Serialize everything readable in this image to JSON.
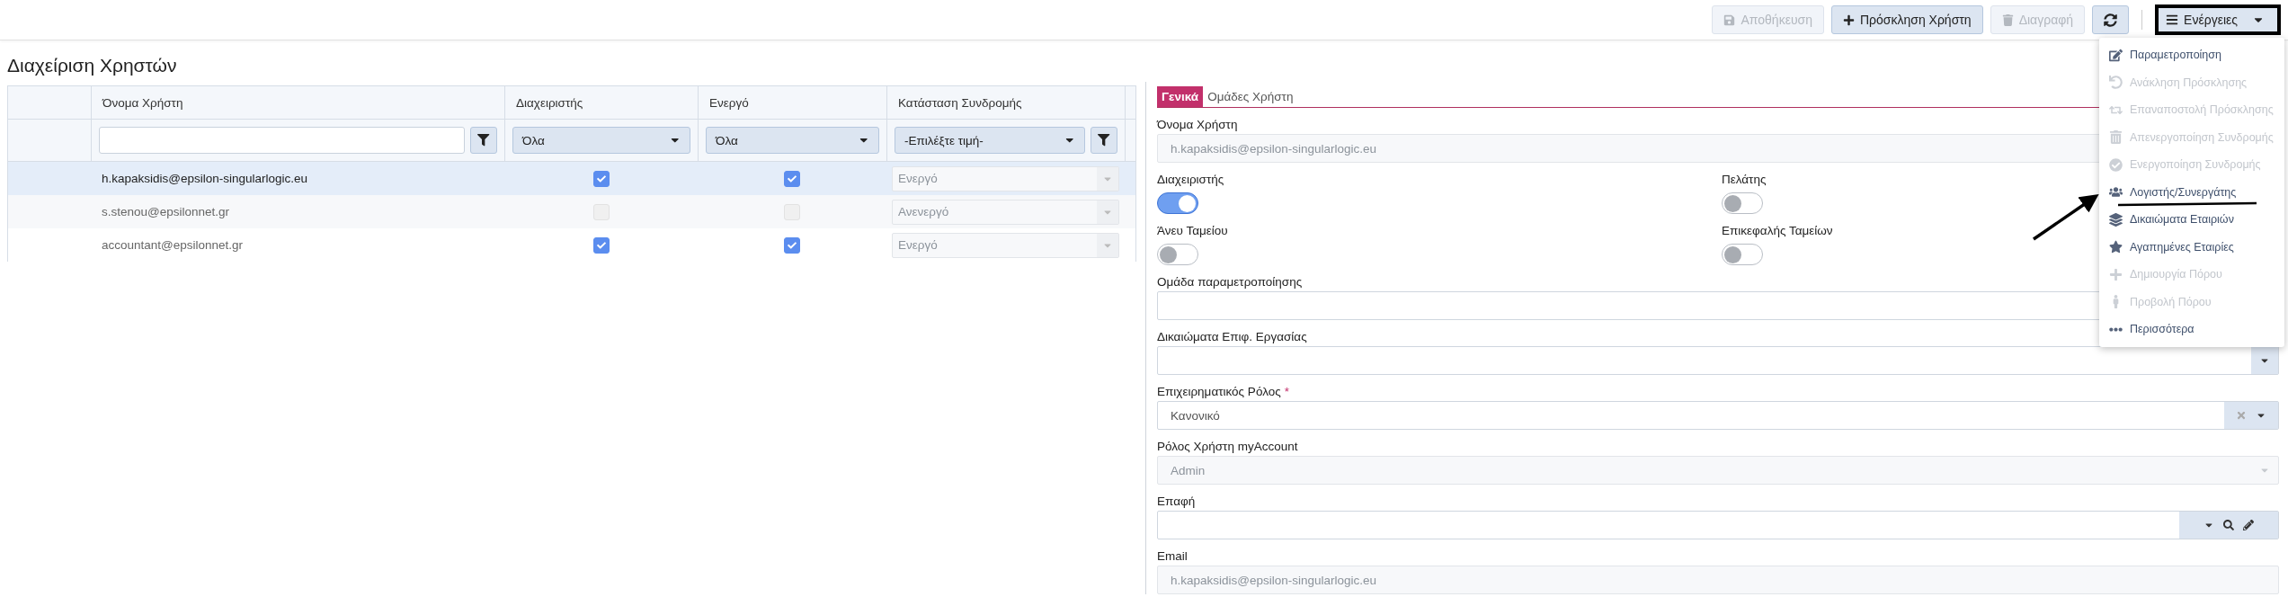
{
  "toolbar": {
    "buttons": [
      {
        "kind": "save",
        "label": "Αποθήκευση",
        "disabled": true
      },
      {
        "kind": "invite",
        "label": "Πρόσκληση Χρήστη",
        "disabled": false
      },
      {
        "kind": "delete",
        "label": "Διαγραφή",
        "disabled": true
      },
      {
        "kind": "refresh",
        "disabled": false
      }
    ],
    "actions": {
      "label": "Ενέργειες",
      "expanded": true
    }
  },
  "actions_menu": [
    {
      "kind": "edit",
      "label": "Παραμετροποίηση",
      "disabled": false
    },
    {
      "kind": "undo",
      "label": "Ανάκληση Πρόσκλησης",
      "disabled": true
    },
    {
      "kind": "resend",
      "label": "Επαναποστολή Πρόσκλησης",
      "disabled": true
    },
    {
      "kind": "trash",
      "label": "Απενεργοποίηση Συνδρομής",
      "disabled": true
    },
    {
      "kind": "check",
      "label": "Ενεργοποίηση Συνδρομής",
      "disabled": true
    },
    {
      "kind": "users",
      "label": "Λογιστής/Συνεργάτης",
      "disabled": false
    },
    {
      "kind": "layers",
      "label": "Δικαιώματα Εταιριών",
      "disabled": false
    },
    {
      "kind": "star",
      "label": "Αγαπημένες Εταιρίες",
      "disabled": false
    },
    {
      "kind": "plus",
      "label": "Δημιουργία Πόρου",
      "disabled": true
    },
    {
      "kind": "person",
      "label": "Προβολή Πόρου",
      "disabled": true
    },
    {
      "kind": "more",
      "label": "Περισσότερα",
      "disabled": false
    }
  ],
  "page_title": "Διαχείριση Χρηστών",
  "table": {
    "columns": [
      "Όνομα Χρήστη",
      "Διαχειριστής",
      "Ενεργό",
      "Κατάσταση Συνδρομής"
    ],
    "filters": {
      "admin": "Όλα",
      "active": "Όλα",
      "status_placeholder": "-Επιλέξτε τιμή-"
    },
    "rows": [
      {
        "username": "h.kapaksidis@epsilon-singularlogic.eu",
        "admin": true,
        "active": true,
        "status": "Ενεργό",
        "selected": true
      },
      {
        "username": "s.stenou@epsilonnet.gr",
        "admin": false,
        "active": false,
        "status": "Ανενεργό",
        "selected": false
      },
      {
        "username": "accountant@epsilonnet.gr",
        "admin": true,
        "active": true,
        "status": "Ενεργό",
        "selected": false
      }
    ]
  },
  "form": {
    "tabs": [
      {
        "label": "Γενικά",
        "selected": true
      },
      {
        "label": "Ομάδες Χρήστη",
        "selected": false
      }
    ],
    "items": [
      {
        "kind": "text",
        "label": "Όνομα Χρήστη",
        "value": "h.kapaksidis@epsilon-singularlogic.eu",
        "disabled": true
      },
      {
        "kind": "toggles",
        "toggles": [
          {
            "label": "Διαχειριστής",
            "on": true
          },
          {
            "label": "Πελάτης",
            "on": false
          }
        ]
      },
      {
        "kind": "toggles",
        "toggles": [
          {
            "label": "Άνευ Ταμείου",
            "on": false
          },
          {
            "label": "Επικεφαλής Ταμείων",
            "on": false
          }
        ]
      },
      {
        "kind": "text",
        "label": "Ομάδα παραμετροποίησης",
        "disabled": false
      },
      {
        "kind": "select",
        "label": "Δικαιώματα Επιφ. Εργασίας",
        "disabled": false
      },
      {
        "kind": "select",
        "label": "Επιχειρηματικός Ρόλος",
        "required_mark": "*",
        "value": "Κανονικό",
        "clearable": true,
        "disabled": false
      },
      {
        "kind": "select",
        "label": "Ρόλος Χρήστη myAccount",
        "value": "Admin",
        "disabled": true
      },
      {
        "kind": "lookup",
        "label": "Επαφή",
        "disabled": false
      },
      {
        "kind": "text",
        "label": "Email",
        "value": "h.kapaksidis@epsilon-singularlogic.eu",
        "disabled": true
      }
    ]
  }
}
